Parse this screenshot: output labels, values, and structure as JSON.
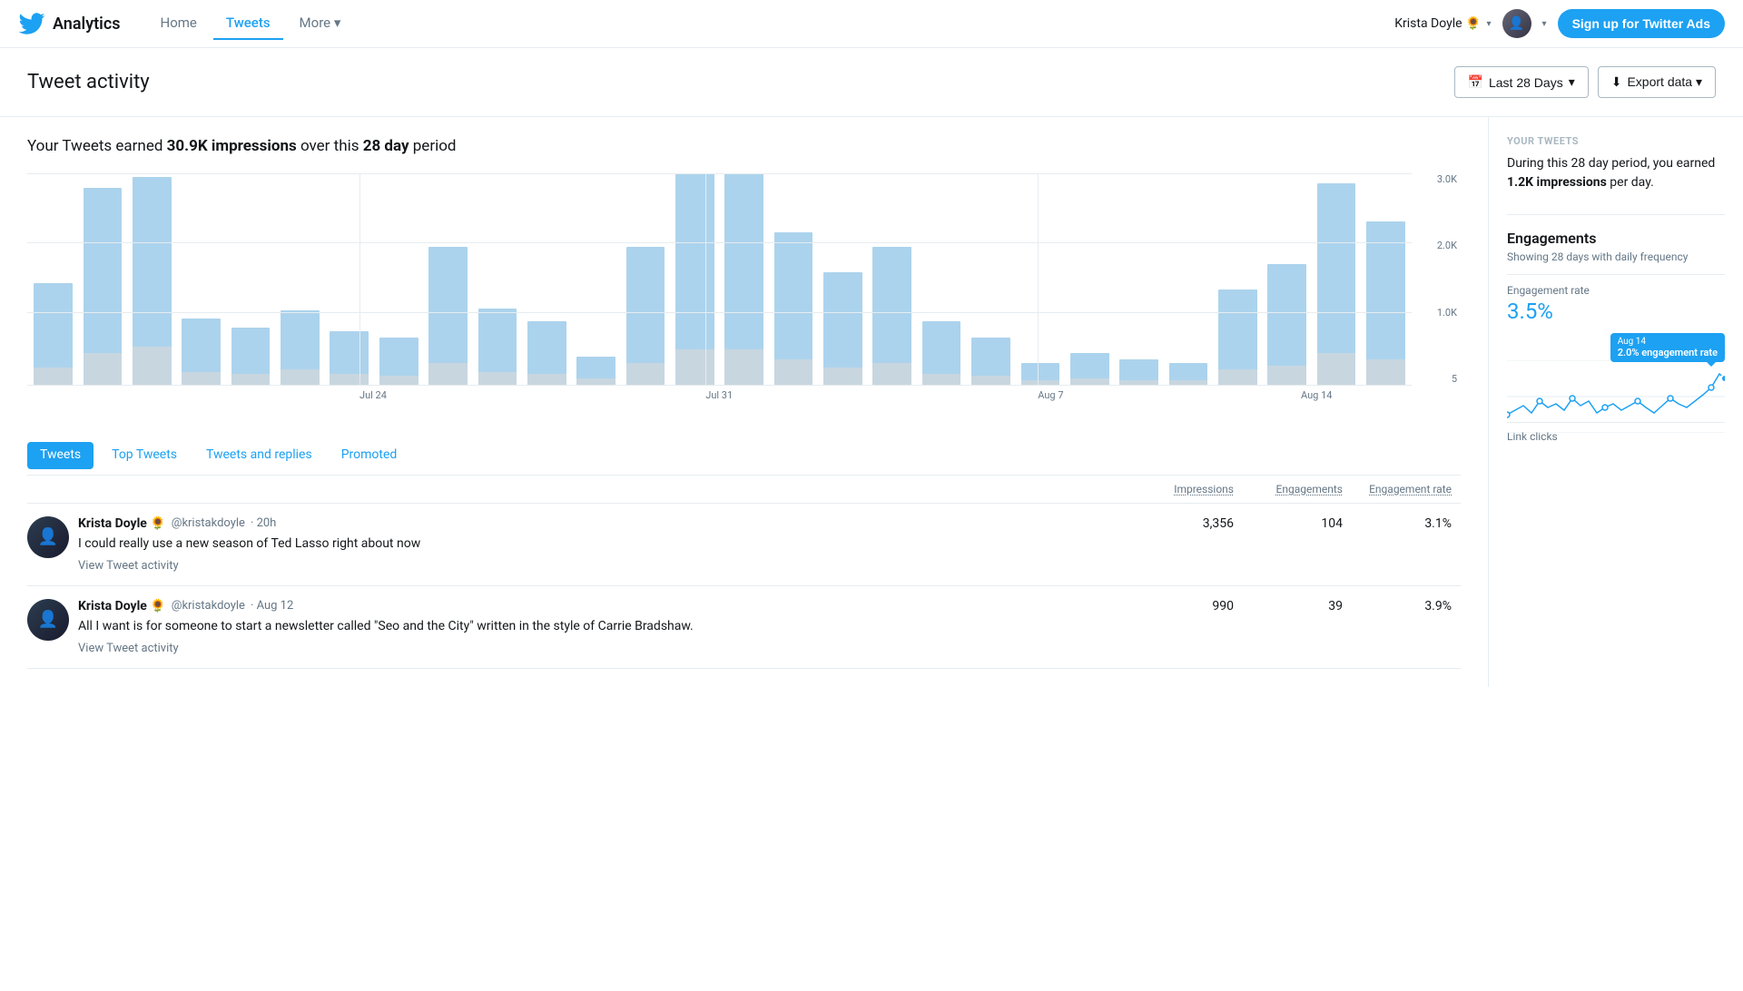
{
  "header": {
    "analytics_label": "Analytics",
    "nav": [
      {
        "id": "home",
        "label": "Home",
        "active": false
      },
      {
        "id": "tweets",
        "label": "Tweets",
        "active": true
      },
      {
        "id": "more",
        "label": "More ▾",
        "active": false
      }
    ],
    "user_name": "Krista Doyle 🌻",
    "user_caret": "▾",
    "avatar_caret": "▾",
    "signup_btn": "Sign up for Twitter Ads"
  },
  "page": {
    "title": "Tweet activity",
    "date_filter": "Last 28 Days",
    "date_filter_icon": "📅",
    "export_label": "Export data ▾",
    "export_icon": "⬇"
  },
  "summary": {
    "prefix": "Your Tweets earned ",
    "impressions": "30.9K impressions",
    "middle": " over this ",
    "period": "28 day",
    "suffix": " period"
  },
  "chart": {
    "y_labels": [
      "3.0K",
      "2.0K",
      "1.0K",
      "5"
    ],
    "x_labels": [
      {
        "label": "Jul 24",
        "position": 24
      },
      {
        "label": "Jul 31",
        "position": 49
      },
      {
        "label": "Aug 7",
        "position": 73
      },
      {
        "label": "Aug 14",
        "position": 95
      }
    ],
    "bars": [
      {
        "impression_pct": 40,
        "eng_pct": 8
      },
      {
        "impression_pct": 78,
        "eng_pct": 15
      },
      {
        "impression_pct": 80,
        "eng_pct": 18
      },
      {
        "impression_pct": 25,
        "eng_pct": 6
      },
      {
        "impression_pct": 22,
        "eng_pct": 5
      },
      {
        "impression_pct": 28,
        "eng_pct": 7
      },
      {
        "impression_pct": 20,
        "eng_pct": 5
      },
      {
        "impression_pct": 18,
        "eng_pct": 4
      },
      {
        "impression_pct": 55,
        "eng_pct": 10
      },
      {
        "impression_pct": 30,
        "eng_pct": 6
      },
      {
        "impression_pct": 25,
        "eng_pct": 5
      },
      {
        "impression_pct": 10,
        "eng_pct": 3
      },
      {
        "impression_pct": 55,
        "eng_pct": 10
      },
      {
        "impression_pct": 90,
        "eng_pct": 18
      },
      {
        "impression_pct": 85,
        "eng_pct": 17
      },
      {
        "impression_pct": 60,
        "eng_pct": 12
      },
      {
        "impression_pct": 45,
        "eng_pct": 8
      },
      {
        "impression_pct": 55,
        "eng_pct": 10
      },
      {
        "impression_pct": 25,
        "eng_pct": 5
      },
      {
        "impression_pct": 18,
        "eng_pct": 4
      },
      {
        "impression_pct": 8,
        "eng_pct": 2
      },
      {
        "impression_pct": 12,
        "eng_pct": 3
      },
      {
        "impression_pct": 10,
        "eng_pct": 2
      },
      {
        "impression_pct": 8,
        "eng_pct": 2
      },
      {
        "impression_pct": 38,
        "eng_pct": 7
      },
      {
        "impression_pct": 48,
        "eng_pct": 9
      },
      {
        "impression_pct": 80,
        "eng_pct": 15
      },
      {
        "impression_pct": 65,
        "eng_pct": 12
      }
    ]
  },
  "tabs": [
    {
      "id": "tweets",
      "label": "Tweets",
      "active": true
    },
    {
      "id": "top-tweets",
      "label": "Top Tweets",
      "active": false
    },
    {
      "id": "tweets-replies",
      "label": "Tweets and replies",
      "active": false
    },
    {
      "id": "promoted",
      "label": "Promoted",
      "active": false
    }
  ],
  "table": {
    "col_impressions": "Impressions",
    "col_engagements": "Engagements",
    "col_engagement_rate": "Engagement rate"
  },
  "tweets": [
    {
      "author": "Krista Doyle 🌻",
      "handle": "@kristakdoyle",
      "time": "· 20h",
      "text": "I could really use a new season of Ted Lasso right about now",
      "view_activity": "View Tweet activity",
      "impressions": "3,356",
      "engagements": "104",
      "engagement_rate": "3.1%"
    },
    {
      "author": "Krista Doyle 🌻",
      "handle": "@kristakdoyle",
      "time": "· Aug 12",
      "text": "All I want is for someone to start a newsletter called \"Seo and the City\" written in the style of Carrie Bradshaw.",
      "view_activity": "View Tweet activity",
      "impressions": "990",
      "engagements": "39",
      "engagement_rate": "3.9%"
    }
  ],
  "right_panel": {
    "your_tweets_title": "YOUR TWEETS",
    "your_tweets_desc_prefix": "During this 28 day period, you earned ",
    "your_tweets_bold": "1.2K impressions",
    "your_tweets_desc_suffix": " per day.",
    "engagements_title": "Engagements",
    "engagements_subtitle": "Showing 28 days with daily frequency",
    "eng_rate_label": "Engagement rate",
    "eng_rate_value": "3.5%",
    "tooltip_date": "Aug 14",
    "tooltip_value": "2.0% engagement rate",
    "bottom_label": "Link clicks"
  }
}
